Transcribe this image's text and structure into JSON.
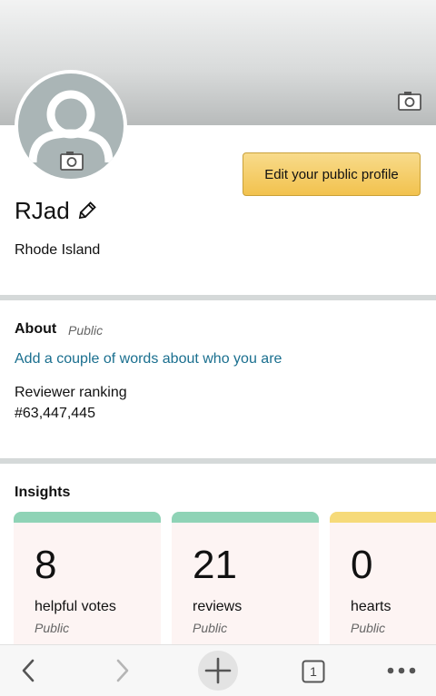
{
  "profile": {
    "name": "RJad",
    "location": "Rhode Island",
    "edit_button": "Edit your public profile"
  },
  "about": {
    "title": "About",
    "visibility": "Public",
    "link": "Add a couple of words about who you are",
    "ranking_label": "Reviewer ranking",
    "ranking_value": "#63,447,445"
  },
  "insights": {
    "title": "Insights",
    "cards": [
      {
        "value": "8",
        "label": "helpful votes",
        "visibility": "Public",
        "accent": "#8fd3b6"
      },
      {
        "value": "21",
        "label": "reviews",
        "visibility": "Public",
        "accent": "#8fd3b6"
      },
      {
        "value": "0",
        "label": "hearts",
        "visibility": "Public",
        "accent": "#f6da79"
      }
    ]
  },
  "browser_bar": {
    "tab_count": "1",
    "icons": [
      "back-icon",
      "forward-icon",
      "new-tab-icon",
      "tabs-icon",
      "more-icon"
    ]
  }
}
